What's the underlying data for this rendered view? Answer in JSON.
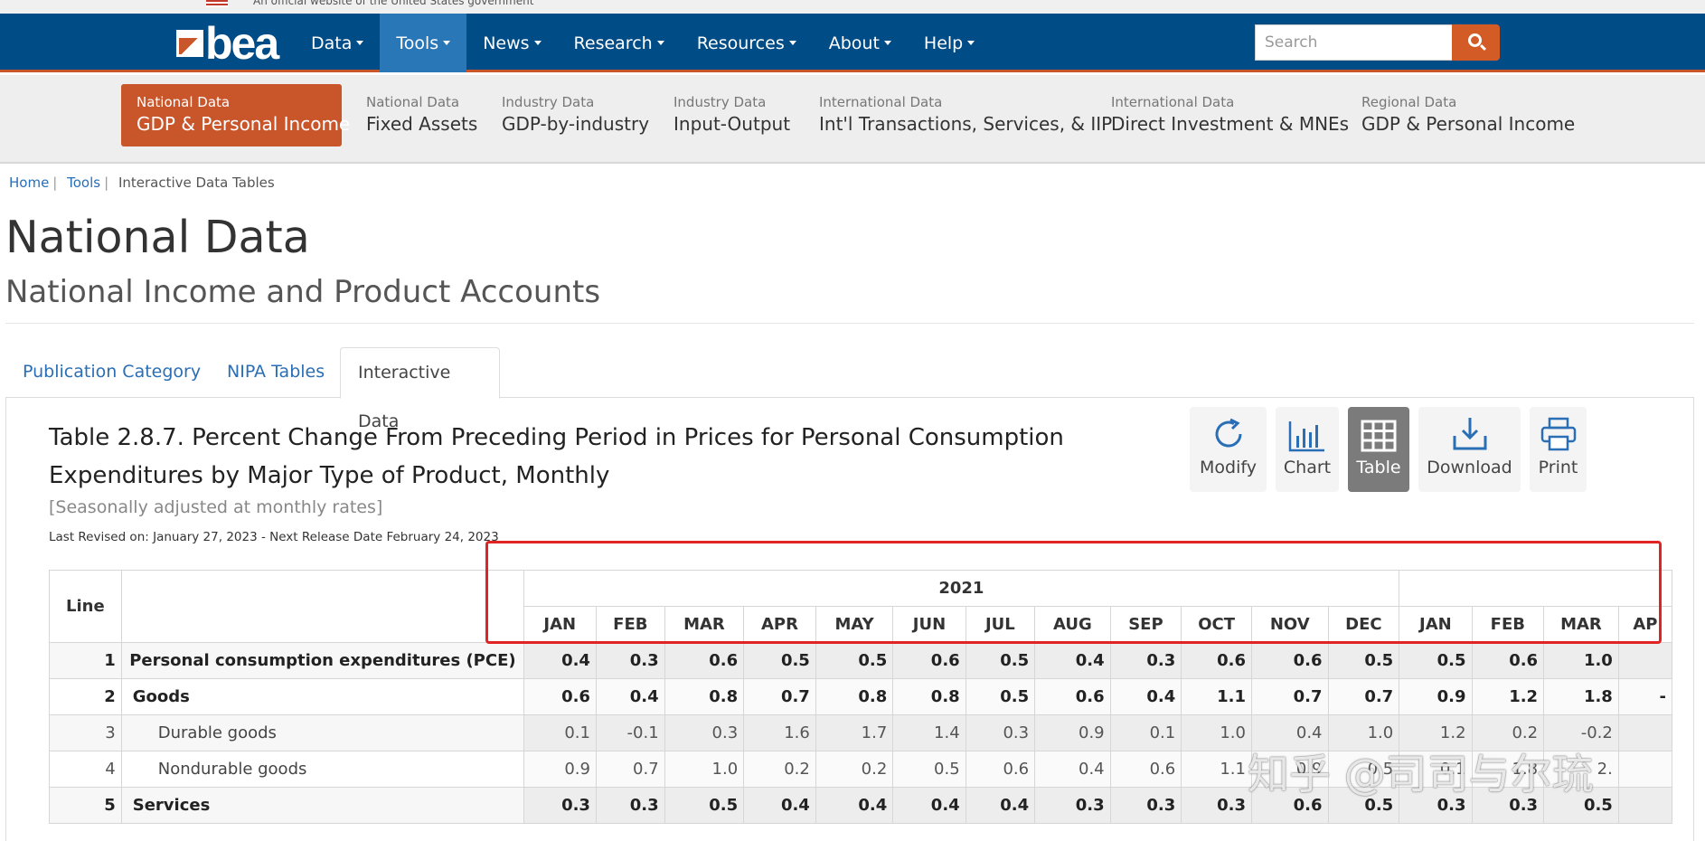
{
  "gov_banner": {
    "text": "An official website of the United States government"
  },
  "logo": {
    "text": "bea"
  },
  "nav": {
    "items": [
      {
        "label": "Data"
      },
      {
        "label": "Tools"
      },
      {
        "label": "News"
      },
      {
        "label": "Research"
      },
      {
        "label": "Resources"
      },
      {
        "label": "About"
      },
      {
        "label": "Help"
      }
    ],
    "search_placeholder": "Search"
  },
  "subnav": [
    {
      "small": "National Data",
      "big": "GDP & Personal Income"
    },
    {
      "small": "National Data",
      "big": "Fixed Assets"
    },
    {
      "small": "Industry Data",
      "big": "GDP-by-industry"
    },
    {
      "small": "Industry Data",
      "big": "Input-Output"
    },
    {
      "small": "International Data",
      "big": "Int'l Transactions, Services, & IIP"
    },
    {
      "small": "International Data",
      "big": "Direct Investment & MNEs"
    },
    {
      "small": "Regional Data",
      "big": "GDP & Personal Income"
    }
  ],
  "breadcrumb": {
    "home": "Home",
    "tools": "Tools",
    "current": "Interactive Data Tables"
  },
  "page_title": "National Data",
  "page_subtitle": "National Income and Product Accounts",
  "tabs": [
    {
      "label": "Publication Category"
    },
    {
      "label": "NIPA Tables"
    },
    {
      "label": "Interactive Data"
    }
  ],
  "table_title": "Table 2.8.7. Percent Change From Preceding Period in Prices for Personal Consumption Expenditures by Major Type of Product, Monthly",
  "table_note": "[Seasonally adjusted at monthly rates]",
  "last_revised": "Last Revised on: January 27, 2023 - Next Release Date February 24, 2023",
  "toolbar": [
    {
      "label": "Modify",
      "icon": "refresh-icon"
    },
    {
      "label": "Chart",
      "icon": "bar-chart-icon"
    },
    {
      "label": "Table",
      "icon": "grid-table-icon"
    },
    {
      "label": "Download",
      "icon": "download-icon"
    },
    {
      "label": "Print",
      "icon": "printer-icon"
    }
  ],
  "data_table": {
    "line_header": "Line",
    "year_header": "2021",
    "months": [
      "JAN",
      "FEB",
      "MAR",
      "APR",
      "MAY",
      "JUN",
      "JUL",
      "AUG",
      "SEP",
      "OCT",
      "NOV",
      "DEC",
      "JAN",
      "FEB",
      "MAR",
      "AP"
    ],
    "rows": [
      {
        "line": "1",
        "label": "Personal consumption expenditures (PCE)",
        "style": "bold",
        "indent": 0,
        "values": [
          "0.4",
          "0.3",
          "0.6",
          "0.5",
          "0.5",
          "0.6",
          "0.5",
          "0.4",
          "0.3",
          "0.6",
          "0.6",
          "0.5",
          "0.5",
          "0.6",
          "1.0",
          ""
        ]
      },
      {
        "line": "2",
        "label": "Goods",
        "style": "bold",
        "indent": 1,
        "values": [
          "0.6",
          "0.4",
          "0.8",
          "0.7",
          "0.8",
          "0.8",
          "0.5",
          "0.6",
          "0.4",
          "1.1",
          "0.7",
          "0.7",
          "0.9",
          "1.2",
          "1.8",
          "-"
        ]
      },
      {
        "line": "3",
        "label": "Durable goods",
        "style": "norm",
        "indent": 2,
        "values": [
          "0.1",
          "-0.1",
          "0.3",
          "1.6",
          "1.7",
          "1.4",
          "0.3",
          "0.9",
          "0.1",
          "1.0",
          "0.4",
          "1.0",
          "1.2",
          "0.2",
          "-0.2",
          ""
        ]
      },
      {
        "line": "4",
        "label": "Nondurable goods",
        "style": "norm",
        "indent": 2,
        "values": [
          "0.9",
          "0.7",
          "1.0",
          "0.2",
          "0.2",
          "0.5",
          "0.6",
          "0.4",
          "0.6",
          "1.1",
          "0.9",
          "0.5",
          "0.1",
          "1.8",
          "2.",
          ""
        ]
      },
      {
        "line": "5",
        "label": "Services",
        "style": "bold",
        "indent": 1,
        "values": [
          "0.3",
          "0.3",
          "0.5",
          "0.4",
          "0.4",
          "0.4",
          "0.4",
          "0.3",
          "0.3",
          "0.3",
          "0.6",
          "0.5",
          "0.3",
          "0.3",
          "0.5",
          ""
        ]
      }
    ]
  },
  "watermark": "知乎 @司司与尔琉",
  "colors": {
    "nav_bg": "#004c87",
    "accent": "#c9552b",
    "link": "#2a6eb5",
    "annotation": "#e02424"
  }
}
